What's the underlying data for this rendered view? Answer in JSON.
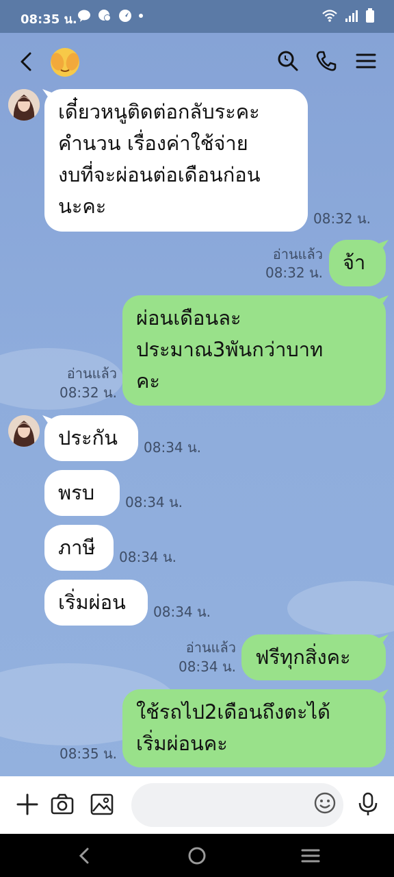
{
  "status_bar": {
    "time": "08:35 น."
  },
  "header": {
    "icons": [
      "back-icon",
      "face-emoji-avatar",
      "search-icon",
      "phone-icon",
      "menu-icon"
    ]
  },
  "messages": [
    {
      "side": "in",
      "lines": [
        "เดี๋ยวหนูติดต่อกลับระคะ",
        "คำนวน เรื่องค่าใช้จ่าย",
        "งบที่จะผ่อนต่อเดือนก่อน",
        "นะคะ"
      ],
      "time": "08:32 น."
    },
    {
      "side": "out",
      "lines": [
        "จ้า"
      ],
      "read": "อ่านแล้ว",
      "time": "08:32 น."
    },
    {
      "side": "out",
      "lines": [
        "ผ่อนเดือนละ",
        "ประมาณ3พันกว่าบาท",
        "คะ"
      ],
      "read": "อ่านแล้ว",
      "time": "08:32 น."
    },
    {
      "side": "in",
      "lines": [
        "ประกัน"
      ],
      "time": "08:34 น."
    },
    {
      "side": "in",
      "lines": [
        "พรบ"
      ],
      "time": "08:34 น."
    },
    {
      "side": "in",
      "lines": [
        "ภาษี"
      ],
      "time": "08:34 น."
    },
    {
      "side": "in",
      "lines": [
        "เริ่มผ่อน"
      ],
      "time": "08:34 น."
    },
    {
      "side": "out",
      "lines": [
        "ฟรีทุกสิ่งคะ"
      ],
      "read": "อ่านแล้ว",
      "time": "08:34 น."
    },
    {
      "side": "out",
      "lines": [
        "ใช้รถไป2เดือนถึงตะได้",
        "เริ่มผ่อนคะ"
      ],
      "read": "",
      "time": "08:35 น."
    }
  ],
  "input_bar": {
    "placeholder": "",
    "icons": [
      "plus-icon",
      "camera-icon",
      "image-icon",
      "emoji-icon",
      "microphone-icon"
    ]
  },
  "colors": {
    "outgoing_bubble": "#99e18a",
    "incoming_bubble": "#ffffff",
    "chat_background": "#8aa7d8",
    "status_bar": "#5b7aa6"
  }
}
